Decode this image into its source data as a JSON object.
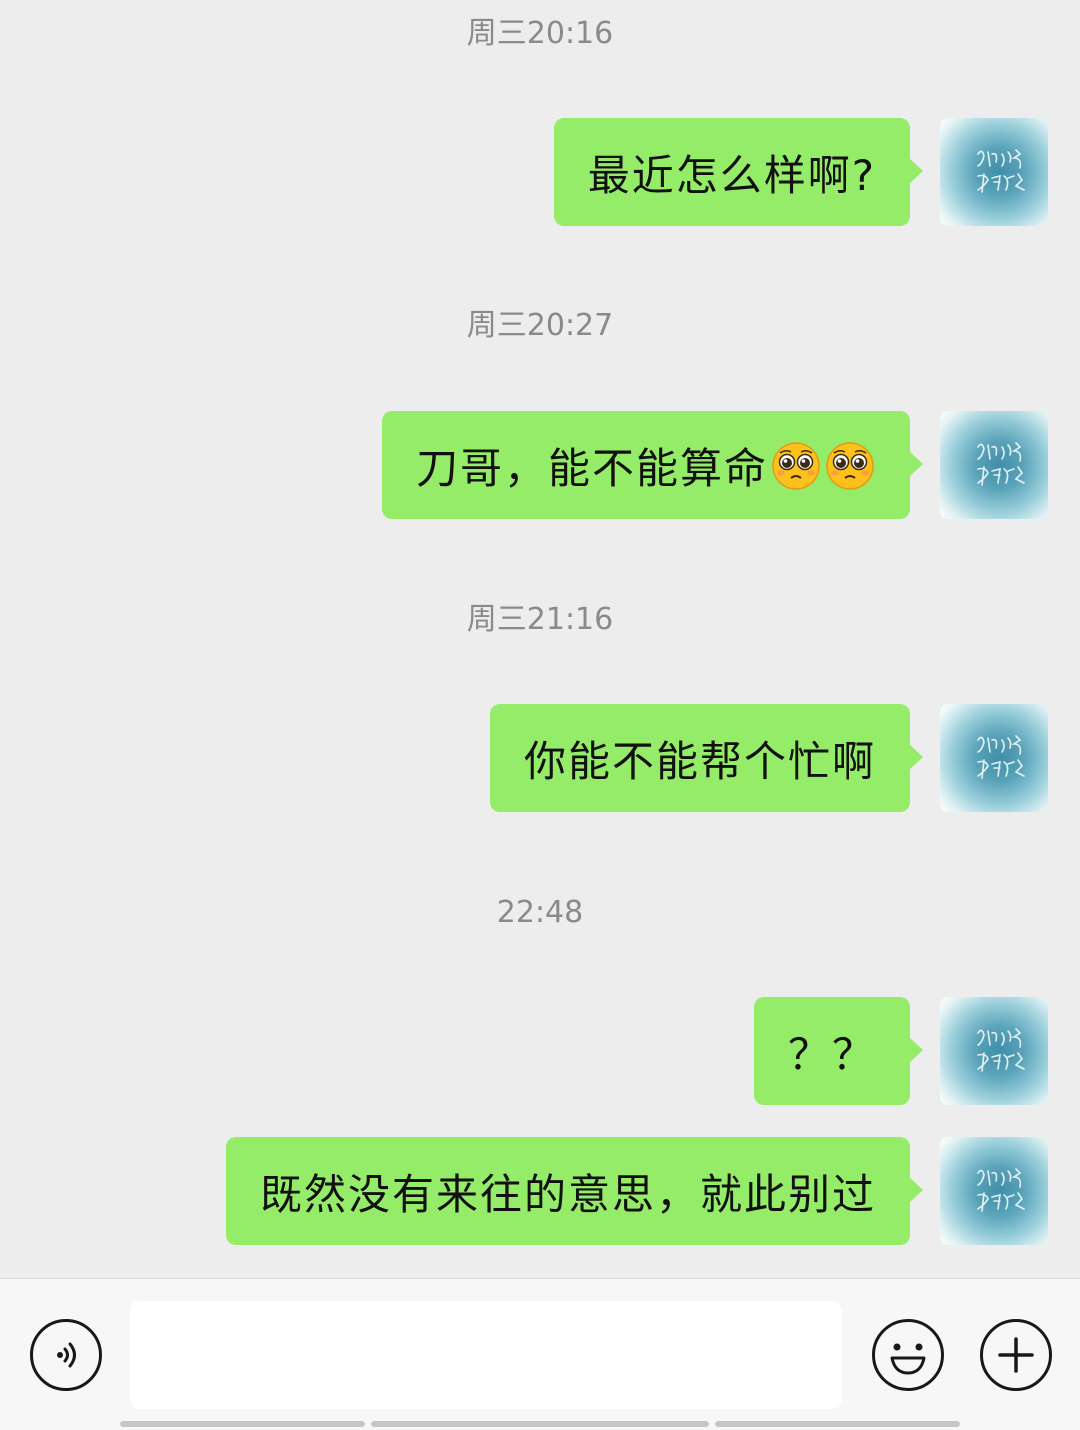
{
  "timestamps": [
    "周三20:16",
    "周三20:27",
    "周三21:16",
    "22:48"
  ],
  "messages": [
    {
      "text": "最近怎么样啊?"
    },
    {
      "text": "刀哥，能不能算命"
    },
    {
      "text": "你能不能帮个忙啊"
    },
    {
      "text": "？？"
    },
    {
      "text": "既然没有来往的意思，就此别过"
    }
  ],
  "avatar": {
    "style": "teal watercolor with handwritten calligraphy",
    "colors": [
      "#3f8ea8",
      "#9acfdb",
      "#ffffff"
    ]
  },
  "emoji": {
    "name": "pleading-face",
    "count": 2
  },
  "input_bar": {
    "voice_icon": "voice-icon",
    "emoji_icon": "smiley-icon",
    "more_icon": "plus-icon",
    "text_value": ""
  },
  "colors": {
    "background": "#ededed",
    "bubble": "#95ec69",
    "timestamp_text": "#8a8a8a",
    "input_bar": "#f7f7f7"
  }
}
